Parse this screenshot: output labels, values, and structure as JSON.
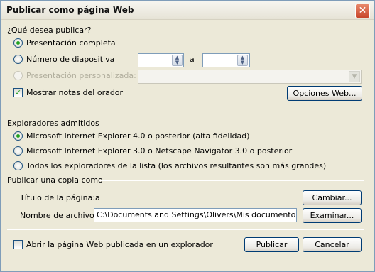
{
  "window": {
    "title": "Publicar como página Web",
    "close_icon": "close-icon"
  },
  "what": {
    "heading": "¿Qué desea publicar?",
    "full": "Presentación completa",
    "slides": "Número de diapositiva",
    "slides_from_value": "",
    "slides_to_label": "a",
    "slides_to_value": "",
    "custom": "Presentación personalizada:",
    "custom_value": "",
    "notes": "Mostrar notas del orador",
    "web_options": "Opciones Web..."
  },
  "browsers": {
    "heading": "Exploradores admitidos",
    "options": [
      "Microsoft Internet Explorer 4.0 o posterior (alta fidelidad)",
      "Microsoft Internet Explorer 3.0 o Netscape Navigator 3.0 o posterior",
      "Todos los exploradores de la lista (los archivos resultantes son más grandes)"
    ]
  },
  "copy": {
    "heading": "Publicar una copia como",
    "page_title_label": "Título de la página:",
    "page_title_value": "a",
    "change": "Cambiar...",
    "file_name_label": "Nombre de archivo:",
    "file_name_value": "C:\\Documents and Settings\\Olivers\\Mis documentos\\Powe",
    "browse": "Examinar..."
  },
  "footer": {
    "open_in_browser": "Abrir la página Web publicada en un explorador",
    "publish": "Publicar",
    "cancel": "Cancelar"
  },
  "colors": {
    "selected_radio": "#21a121",
    "title_bar": "#e6e3d6"
  }
}
